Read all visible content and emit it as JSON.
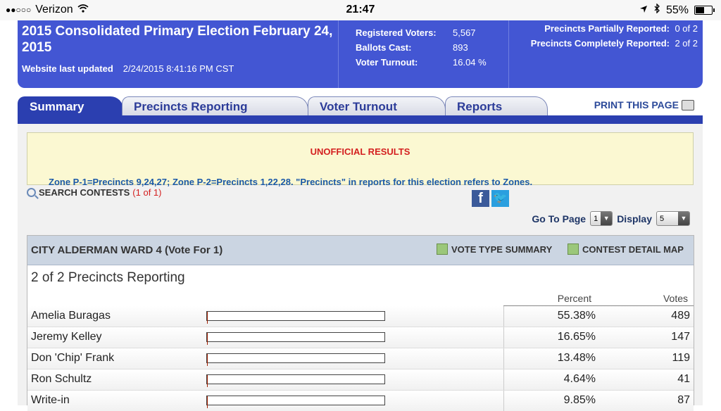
{
  "statusbar": {
    "carrier": "Verizon",
    "time": "21:47",
    "battery": "55%"
  },
  "header": {
    "title": "2015 Consolidated Primary Election February 24, 2015",
    "updated_label": "Website last updated",
    "updated_value": "2/24/2015 8:41:16 PM CST",
    "registered_label": "Registered Voters:",
    "registered_value": "5,567",
    "ballots_label": "Ballots Cast:",
    "ballots_value": "893",
    "turnout_label": "Voter Turnout:",
    "turnout_value": "16.04 %",
    "partial_label": "Precincts Partially Reported:",
    "partial_value": "0 of 2",
    "complete_label": "Precincts Completely Reported:",
    "complete_value": "2 of 2"
  },
  "tabs": [
    {
      "label": "Summary"
    },
    {
      "label": "Precincts Reporting"
    },
    {
      "label": "Voter Turnout"
    },
    {
      "label": "Reports"
    }
  ],
  "print_label": "PRINT THIS PAGE",
  "notice": {
    "title": "UNOFFICIAL RESULTS",
    "message": "Zone P-1=Precincts 9,24,27; Zone P-2=Precincts 1,22,28. \"Precincts\" in reports for this election refers to Zones."
  },
  "search": {
    "label": "SEARCH CONTESTS",
    "count": "(1 of 1)"
  },
  "paging": {
    "goto_label": "Go To Page",
    "goto_value": "1",
    "display_label": "Display",
    "display_value": "5"
  },
  "contest": {
    "name": "CITY ALDERMAN WARD 4 (Vote For 1)",
    "vote_type_label": "VOTE TYPE SUMMARY",
    "map_label": "CONTEST DETAIL MAP",
    "reporting": "2 of 2 Precincts Reporting",
    "col_percent": "Percent",
    "col_votes": "Votes",
    "candidates": [
      {
        "name": "Amelia Buragas",
        "percent": "55.38%",
        "votes": "489",
        "share": 0.5538
      },
      {
        "name": "Jeremy Kelley",
        "percent": "16.65%",
        "votes": "147",
        "share": 0.1665
      },
      {
        "name": "Don 'Chip' Frank",
        "percent": "13.48%",
        "votes": "119",
        "share": 0.1348
      },
      {
        "name": "Ron Schultz",
        "percent": "4.64%",
        "votes": "41",
        "share": 0.0464
      },
      {
        "name": "Write-in",
        "percent": "9.85%",
        "votes": "87",
        "share": 0.0985
      }
    ]
  }
}
